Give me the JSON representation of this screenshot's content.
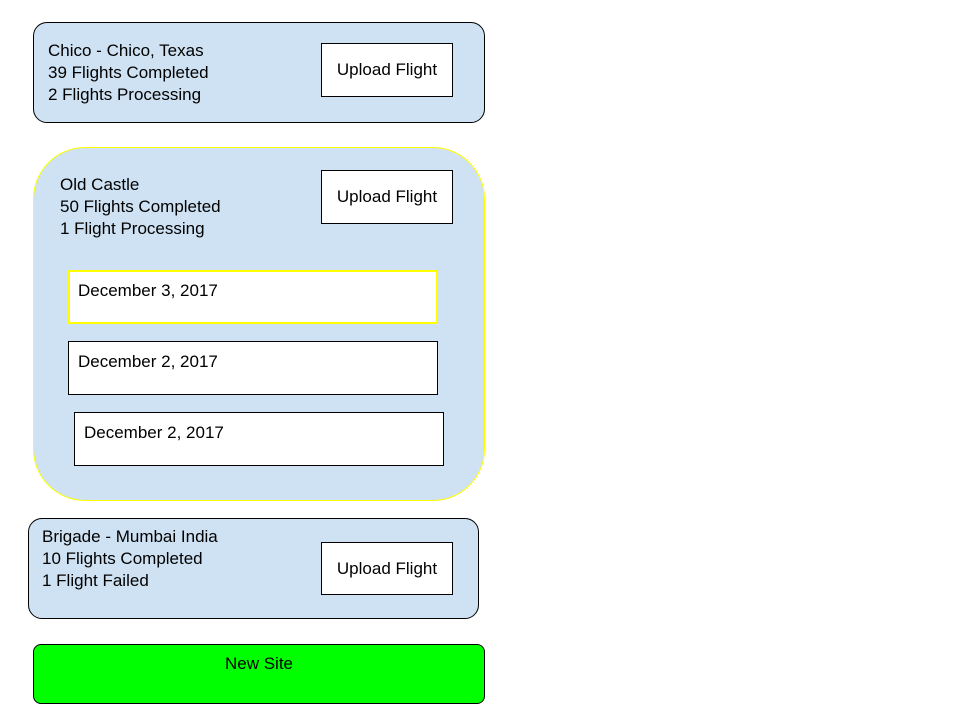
{
  "sites": [
    {
      "name": "Chico - Chico, Texas",
      "completed": "39 Flights Completed",
      "status": "2 Flights Processing",
      "upload_label": "Upload Flight"
    },
    {
      "name": "Old Castle",
      "completed": "50 Flights Completed",
      "status": "1 Flight Processing",
      "upload_label": "Upload Flight",
      "flights": [
        {
          "date": "December 3, 2017"
        },
        {
          "date": "December 2, 2017"
        },
        {
          "date": "December 2, 2017"
        }
      ]
    },
    {
      "name": "Brigade - Mumbai India",
      "completed": "10 Flights Completed",
      "status": "1 Flight Failed",
      "upload_label": "Upload Flight"
    }
  ],
  "new_site_label": "New Site",
  "colors": {
    "card_background": "#cfe2f3",
    "selected_outline": "#ffff00",
    "new_site_button": "#00ff00"
  }
}
